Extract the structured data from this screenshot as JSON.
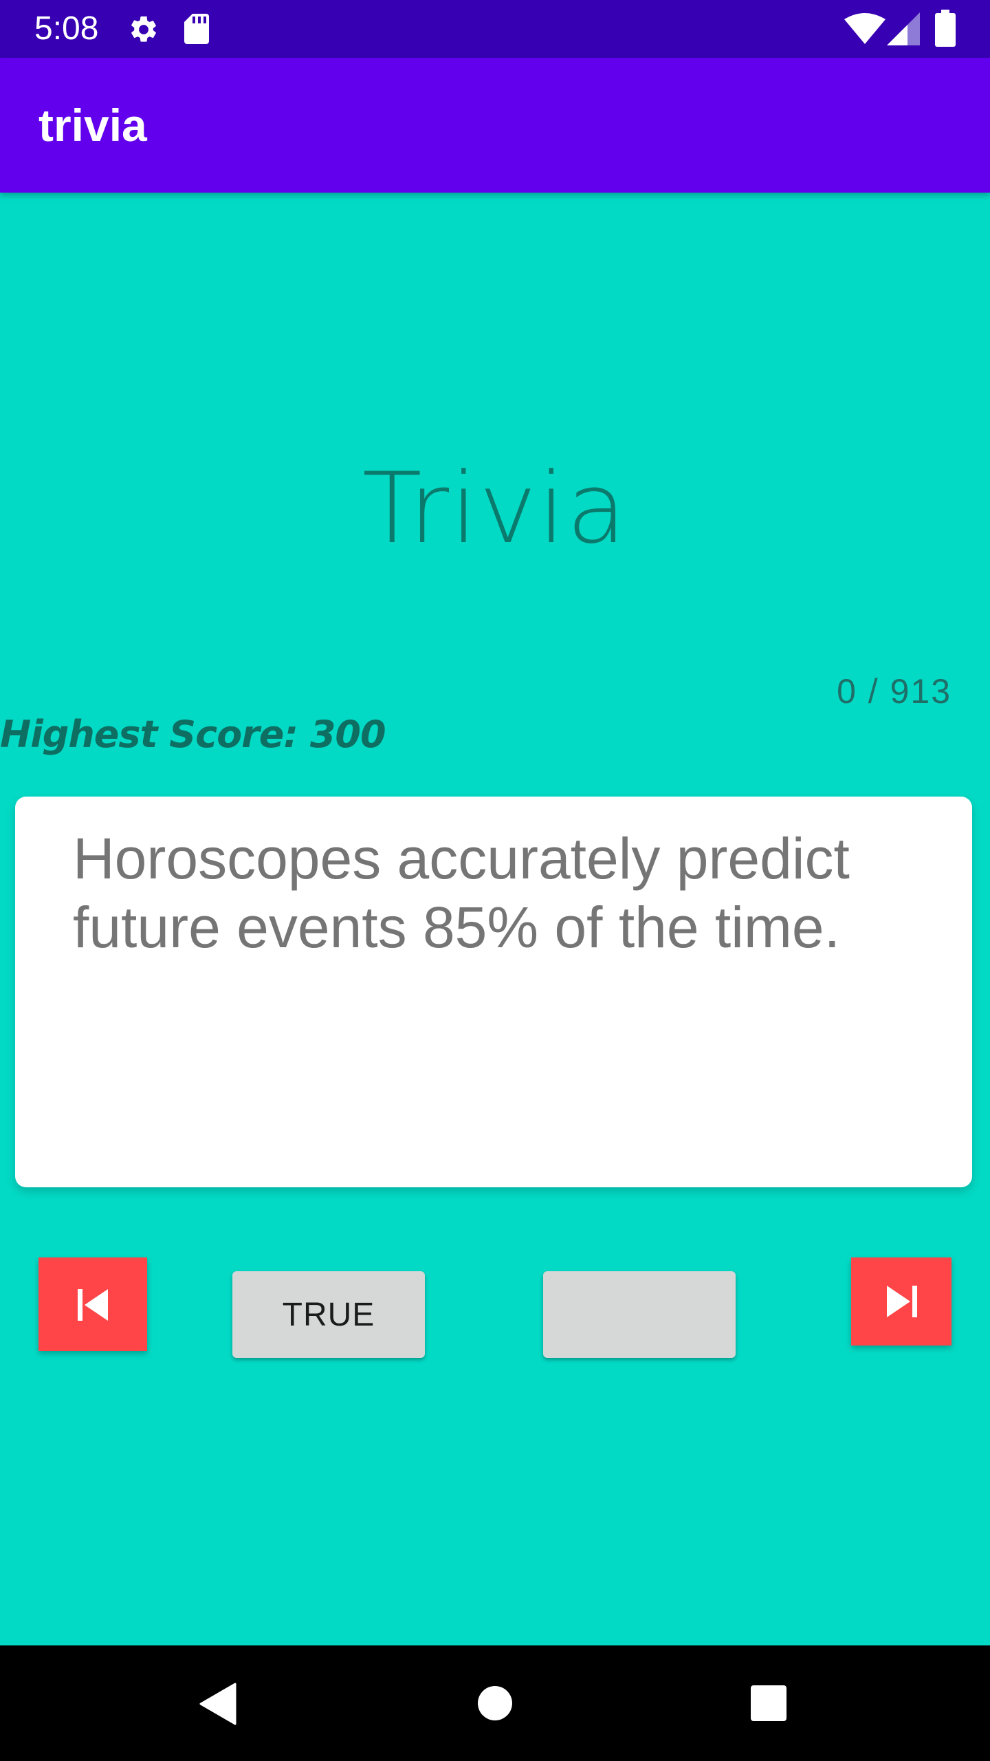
{
  "status_bar": {
    "time": "5:08",
    "icons": [
      "settings-gear-icon",
      "sd-card-icon",
      "wifi-icon",
      "cellular-signal-icon",
      "battery-icon"
    ]
  },
  "app_bar": {
    "title": "trivia"
  },
  "main": {
    "hero_title": "Trivia",
    "counter": "0 / 913",
    "high_score": "Highest Score: 300",
    "question": "Horoscopes accurately predict future events 85% of the time."
  },
  "controls": {
    "prev_icon": "skip-previous-icon",
    "true_label": "TRUE",
    "false_label": "",
    "next_icon": "skip-next-icon"
  },
  "system_nav": {
    "icons": [
      "back-triangle-icon",
      "home-circle-icon",
      "recents-square-icon"
    ]
  },
  "colors": {
    "background": "#03DAC5",
    "status_bar": "#3700B3",
    "app_bar": "#6200EE",
    "nav_button": "#FF4548",
    "answer_button": "#D6D7D7",
    "card": "#FFFFFF"
  }
}
